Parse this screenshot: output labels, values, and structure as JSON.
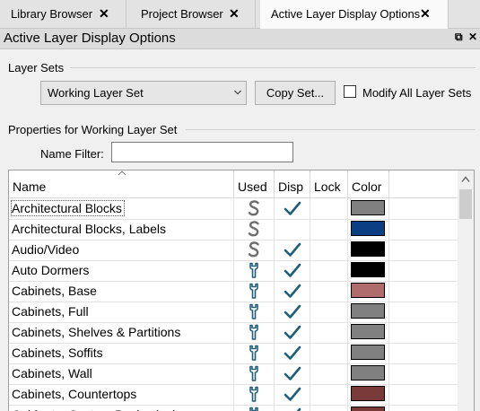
{
  "tabs": [
    {
      "label": "Library Browser",
      "close": "✕",
      "active": false
    },
    {
      "label": "Project Browser",
      "close": "✕",
      "active": false
    },
    {
      "label": "Active Layer Display Options",
      "close": "✕",
      "active": true
    }
  ],
  "panel": {
    "title": "Active Layer Display Options",
    "float_glyph": "⧉",
    "close_glyph": "✕"
  },
  "layer_sets": {
    "group_label": "Layer Sets",
    "selected": "Working Layer Set",
    "copy_button": "Copy Set...",
    "modify_all_label": "Modify All Layer Sets",
    "modify_all_checked": false
  },
  "properties": {
    "group_label": "Properties for  Working Layer Set",
    "name_filter_label": "Name Filter:",
    "name_filter_value": ""
  },
  "columns": {
    "name": "Name",
    "used": "Used",
    "disp": "Disp",
    "lock": "Lock",
    "color": "Color"
  },
  "rows": [
    {
      "name": "Architectural Blocks",
      "used": "S",
      "disp": true,
      "lock": false,
      "color": "#808080",
      "selected": true
    },
    {
      "name": "Architectural Blocks, Labels",
      "used": "S",
      "disp": false,
      "lock": false,
      "color": "#0a3f84"
    },
    {
      "name": "Audio/Video",
      "used": "S",
      "disp": true,
      "lock": false,
      "color": "#000000"
    },
    {
      "name": "Auto Dormers",
      "used": "wrench",
      "disp": true,
      "lock": false,
      "color": "#000000"
    },
    {
      "name": "Cabinets,  Base",
      "used": "wrench",
      "disp": true,
      "lock": false,
      "color": "#b06c6c"
    },
    {
      "name": "Cabinets,  Full",
      "used": "wrench",
      "disp": true,
      "lock": false,
      "color": "#808080"
    },
    {
      "name": "Cabinets,  Shelves & Partitions",
      "used": "wrench",
      "disp": true,
      "lock": false,
      "color": "#808080"
    },
    {
      "name": "Cabinets,  Soffits",
      "used": "wrench",
      "disp": true,
      "lock": false,
      "color": "#808080"
    },
    {
      "name": "Cabinets,  Wall",
      "used": "wrench",
      "disp": true,
      "lock": false,
      "color": "#808080"
    },
    {
      "name": "Cabinets, Countertops",
      "used": "wrench",
      "disp": true,
      "lock": false,
      "color": "#7a3a3a"
    },
    {
      "name": "Cabinets, Custom Backsplash",
      "used": "wrench",
      "disp": true,
      "lock": false,
      "color": "#7a3a3a"
    }
  ],
  "icons": {
    "used_s": "s-letter-icon",
    "used_wrench": "wrench-icon",
    "disp": "checkmark-icon"
  },
  "accent": {
    "icon_teal": "#1f5f7a",
    "s_gray": "#6e6e6e"
  }
}
